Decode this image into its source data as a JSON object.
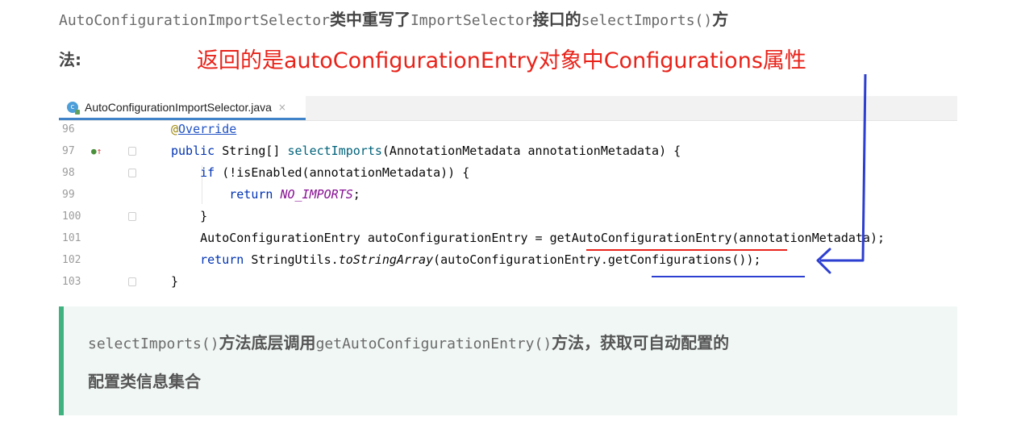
{
  "intro": {
    "part1": "AutoConfigurationImportSelector",
    "part2": "类中重写了",
    "part3": "ImportSelector",
    "part4": "接口的",
    "part5": "selectImports()",
    "part6": "方",
    "line2": "法:"
  },
  "annotation": {
    "red_text": "返回的是autoConfigurationEntry对象中Configurations属性"
  },
  "editor": {
    "tab_label": "AutoConfigurationImportSelector.java",
    "tab_close": "×",
    "tab_icon": "c",
    "lines": [
      {
        "num": "96",
        "segments": [
          {
            "t": "@",
            "c": "ann"
          },
          {
            "t": "Override",
            "c": "ann-name"
          }
        ]
      },
      {
        "num": "97",
        "segments": [
          {
            "t": "public ",
            "c": "kw"
          },
          {
            "t": "String[] ",
            "c": ""
          },
          {
            "t": "selectImports",
            "c": "method"
          },
          {
            "t": "(AnnotationMetadata annotationMetadata) {",
            "c": ""
          }
        ]
      },
      {
        "num": "98",
        "segments": [
          {
            "t": "    if ",
            "c": "kw"
          },
          {
            "t": "(!isEnabled(annotationMetadata)) {",
            "c": ""
          }
        ]
      },
      {
        "num": "99",
        "segments": [
          {
            "t": "        return ",
            "c": "kw"
          },
          {
            "t": "NO_IMPORTS",
            "c": "const"
          },
          {
            "t": ";",
            "c": ""
          }
        ]
      },
      {
        "num": "100",
        "segments": [
          {
            "t": "    }",
            "c": ""
          }
        ]
      },
      {
        "num": "101",
        "segments": [
          {
            "t": "    AutoConfigurationEntry autoConfigurationEntry = getAutoConfigurationEntry(annotationMetadata);",
            "c": ""
          }
        ]
      },
      {
        "num": "102",
        "segments": [
          {
            "t": "    return ",
            "c": "kw"
          },
          {
            "t": "StringUtils.",
            "c": ""
          },
          {
            "t": "toStringArray",
            "c": "static-call"
          },
          {
            "t": "(autoConfigurationEntry.getConfigurations());",
            "c": ""
          }
        ]
      },
      {
        "num": "103",
        "segments": [
          {
            "t": "}",
            "c": ""
          }
        ]
      }
    ]
  },
  "note": {
    "part1": "selectImports()",
    "part2": "方法底层调用",
    "part3": "getAutoConfigurationEntry()",
    "part4": "方法，获取可自动配置的",
    "line2": "配置类信息集合"
  },
  "colors": {
    "red": "#e8231a",
    "blue_arrow": "#2d3fd0",
    "note_accent": "#3fb27f",
    "tab_underline": "#4083c9"
  }
}
